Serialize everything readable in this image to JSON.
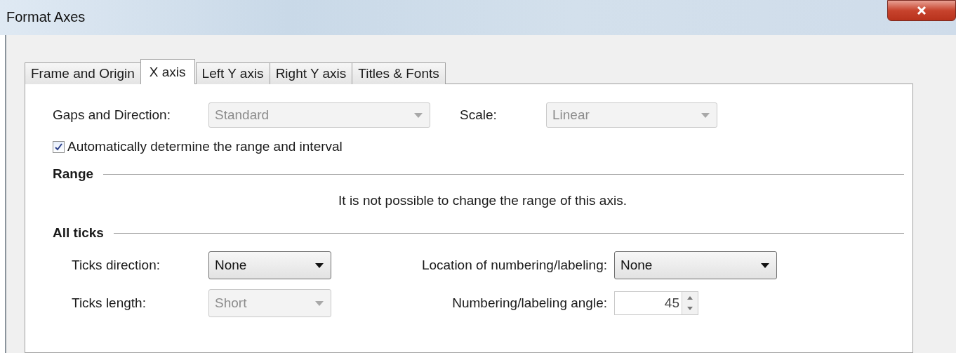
{
  "window": {
    "title": "Format Axes"
  },
  "tabs": [
    {
      "label": "Frame and Origin",
      "selected": false
    },
    {
      "label": "X axis",
      "selected": true
    },
    {
      "label": "Left Y axis",
      "selected": false
    },
    {
      "label": "Right Y axis",
      "selected": false
    },
    {
      "label": "Titles & Fonts",
      "selected": false
    }
  ],
  "top_fields": [
    {
      "kind": "combo",
      "label": "Gaps and Direction:",
      "value": "Standard",
      "disabled": true
    },
    {
      "kind": "combo",
      "label": "Scale:",
      "value": "Linear",
      "disabled": true
    }
  ],
  "auto_range": {
    "label": "Automatically determine the range and interval",
    "checked": true
  },
  "range": {
    "heading": "Range",
    "message": "It is not possible to change the range of this axis."
  },
  "all_ticks": {
    "heading": "All ticks",
    "fields": [
      {
        "kind": "combo",
        "label": "Ticks direction:",
        "value": "None",
        "disabled": false
      },
      {
        "kind": "combo",
        "label": "Location of numbering/labeling:",
        "value": "None",
        "disabled": false
      },
      {
        "kind": "combo",
        "label": "Ticks length:",
        "value": "Short",
        "disabled": true
      },
      {
        "kind": "spin",
        "label": "Numbering/labeling angle:",
        "value": "45",
        "disabled": false
      }
    ]
  }
}
